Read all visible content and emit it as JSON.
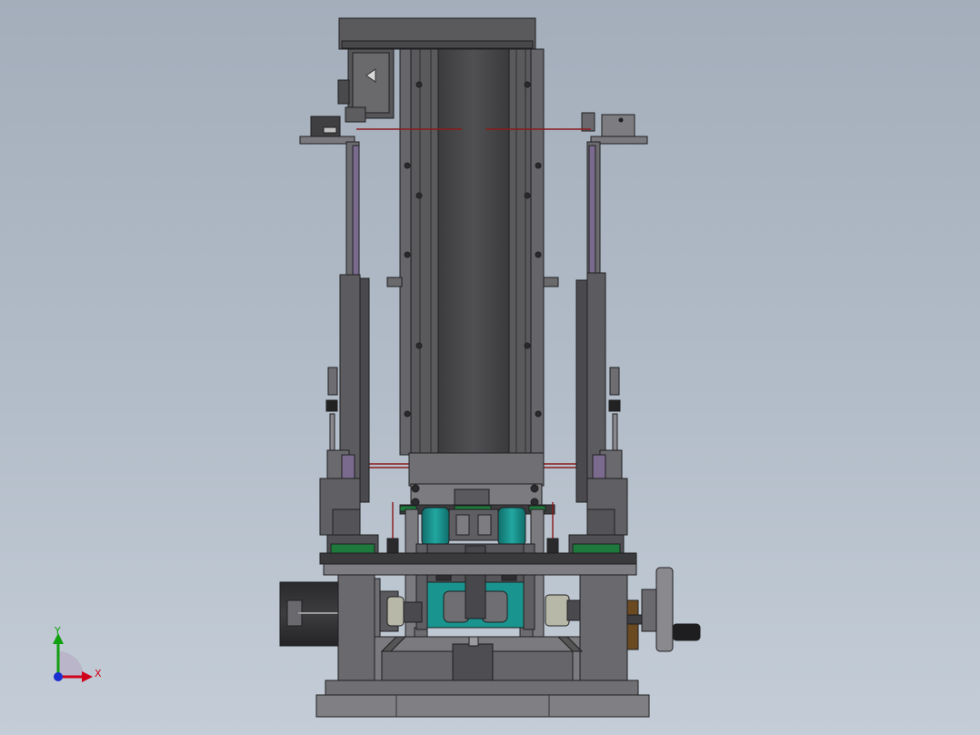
{
  "triad": {
    "x_label": "X",
    "y_label": "Y",
    "x_color": "#d0021b",
    "y_color": "#10a010",
    "z_color": "#1a2fd0"
  },
  "colors": {
    "steel_dark": "#4a4a4c",
    "steel_mid": "#6d6d70",
    "steel_light": "#8e8e92",
    "steel_edge": "#222224",
    "teal": "#19948f",
    "green_pad": "#1e7a3c",
    "purple_rail": "#7a6a8e",
    "laser_line": "#8b1a1a",
    "handle_brown": "#6b4a22"
  }
}
